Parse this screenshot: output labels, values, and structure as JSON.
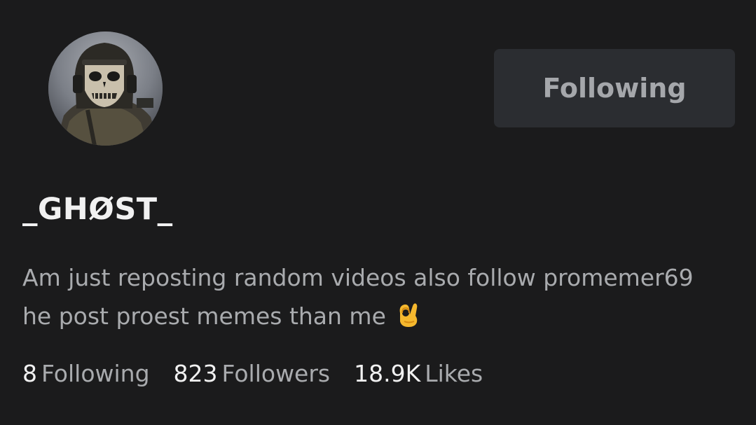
{
  "profile": {
    "username": "_GHØST_",
    "avatar_icon": "masked-soldier-avatar",
    "bio_line1": "Am just reposting random videos also follow promemer69",
    "bio_line2": "he post proest memes than me",
    "bio_emoji_icon": "ok-hand-emoji"
  },
  "actions": {
    "follow_label": "Following"
  },
  "stats": {
    "following_count": "8",
    "following_label": "Following",
    "followers_count": "823",
    "followers_label": "Followers",
    "likes_count": "18.9K",
    "likes_label": "Likes"
  },
  "colors": {
    "background": "#1b1b1c",
    "button_bg": "#2b2d31",
    "button_text": "#a5a7ab",
    "primary_text": "#f1f1f1",
    "secondary_text": "#a9abae"
  }
}
